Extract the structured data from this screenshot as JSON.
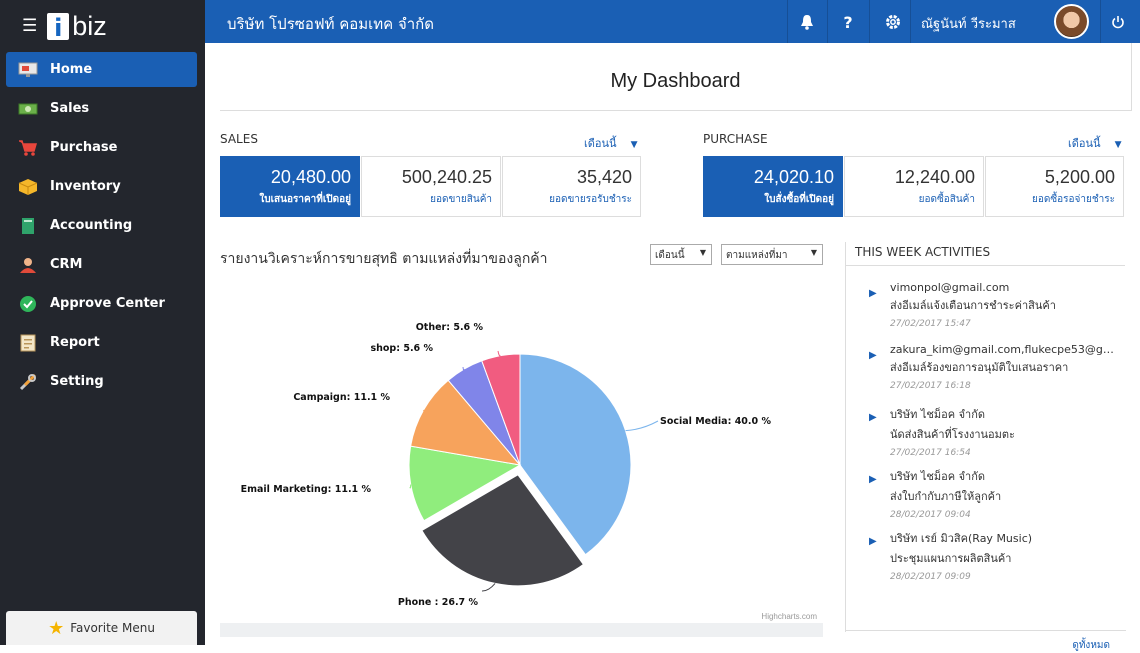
{
  "app": {
    "logo_letter": "i",
    "logo_rest": "biz"
  },
  "sidebar": {
    "items": [
      {
        "label": "Home",
        "icon": "monitor-icon",
        "active": true
      },
      {
        "label": "Sales",
        "icon": "cash-icon"
      },
      {
        "label": "Purchase",
        "icon": "cart-icon"
      },
      {
        "label": "Inventory",
        "icon": "box-icon"
      },
      {
        "label": "Accounting",
        "icon": "ledger-icon"
      },
      {
        "label": "CRM",
        "icon": "people-icon"
      },
      {
        "label": "Approve Center",
        "icon": "check-circle-icon"
      },
      {
        "label": "Report",
        "icon": "report-icon"
      },
      {
        "label": "Setting",
        "icon": "tools-icon"
      }
    ],
    "favorite": "Favorite Menu"
  },
  "topbar": {
    "company": "บริษัท โปรซอฟท์ คอมเทค จำกัด",
    "user": "ณัฐนันท์ วีระมาส"
  },
  "dashboard": {
    "title": "My Dashboard"
  },
  "sales": {
    "label": "SALES",
    "period": "เดือนนี้",
    "kpis": [
      {
        "value": "20,480.00",
        "label": "ใบเสนอราคาที่เปิดอยู่"
      },
      {
        "value": "500,240.25",
        "label": "ยอดขายสินค้า"
      },
      {
        "value": "35,420",
        "label": "ยอดขายรอรับชำระ"
      }
    ]
  },
  "purchase": {
    "label": "PURCHASE",
    "period": "เดือนนี้",
    "kpis": [
      {
        "value": "24,020.10",
        "label": "ใบสั่งซื้อที่เปิดอยู่"
      },
      {
        "value": "12,240.00",
        "label": "ยอดซื้อสินค้า"
      },
      {
        "value": "5,200.00",
        "label": "ยอดซื้อรอจ่ายชำระ"
      }
    ]
  },
  "report": {
    "title": "รายงานวิเคราะห์การขายสุทธิ ตามแหล่งที่มาของลูกค้า",
    "filter_period": "เดือนนี้",
    "filter_source": "ตามแหล่งที่มา",
    "credit": "Highcharts.com"
  },
  "chart_data": {
    "type": "pie",
    "title": "",
    "series": [
      {
        "values": [
          40.0,
          26.7,
          11.1,
          11.1,
          5.6,
          5.6
        ]
      }
    ],
    "categories": [
      "Social Media",
      "Phone ",
      "Email Marketing",
      "Campaign",
      "shop",
      "Other"
    ],
    "labels": [
      "Social Media: 40.0 %",
      "Phone : 26.7 %",
      "Email Marketing: 11.1 %",
      "Campaign: 11.1 %",
      "shop: 5.6 %",
      "Other: 5.6 %"
    ],
    "colors": [
      "#7cb5ec",
      "#434348",
      "#90ed7d",
      "#f7a35c",
      "#8085e9",
      "#f15c80"
    ],
    "sliced": "Phone "
  },
  "activities": {
    "title": "THIS WEEK ACTIVITIES",
    "items": [
      {
        "who": "vimonpol@gmail.com",
        "what": "ส่งอีเมล์แจ้งเตือนการชำระค่าสินค้า",
        "when": "27/02/2017 15:47"
      },
      {
        "who": "zakura_kim@gmail.com,flukecpe53@gmail.c...",
        "what": "ส่งอีเมล์ร้องขอการอนุมัติใบเสนอราคา",
        "when": "27/02/2017 16:18"
      },
      {
        "who": "บริษัท ไชม็อค จำกัด",
        "what": "นัดส่งสินค้าที่โรงงานอมตะ",
        "when": "27/02/2017 16:54"
      },
      {
        "who": "บริษัท ไชม็อค จำกัด",
        "what": "ส่งใบกำกับภาษีให้ลูกค้า",
        "when": "28/02/2017 09:04"
      },
      {
        "who": "บริษัท เรย์ มิวสิค(Ray Music)",
        "what": "ประชุมแผนการผลิตสินค้า",
        "when": "28/02/2017 09:09"
      }
    ],
    "see_all": "ดูทั้งหมด"
  },
  "colors": {
    "brand": "#1a5fb4",
    "sidebar": "#23262d"
  }
}
